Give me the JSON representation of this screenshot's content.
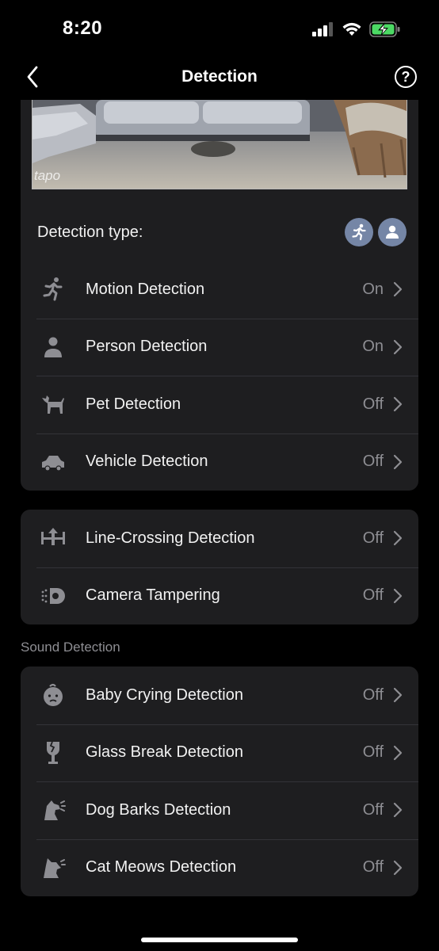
{
  "status_bar": {
    "time": "8:20"
  },
  "nav": {
    "title": "Detection",
    "help_label": "?"
  },
  "preview": {
    "watermark": "tapo"
  },
  "detection_type": {
    "label": "Detection type:",
    "badges": [
      "running-person-icon",
      "person-icon"
    ]
  },
  "object_detection": [
    {
      "icon": "running-person-icon",
      "label": "Motion Detection",
      "value": "On"
    },
    {
      "icon": "person-icon",
      "label": "Person Detection",
      "value": "On"
    },
    {
      "icon": "dog-icon",
      "label": "Pet Detection",
      "value": "Off"
    },
    {
      "icon": "car-icon",
      "label": "Vehicle Detection",
      "value": "Off"
    }
  ],
  "area_detection": [
    {
      "icon": "line-crossing-icon",
      "label": "Line-Crossing Detection",
      "value": "Off"
    },
    {
      "icon": "camera-tampering-icon",
      "label": "Camera Tampering",
      "value": "Off"
    }
  ],
  "sound_section": {
    "header": "Sound Detection",
    "items": [
      {
        "icon": "baby-icon",
        "label": "Baby Crying Detection",
        "value": "Off"
      },
      {
        "icon": "broken-glass-icon",
        "label": "Glass Break Detection",
        "value": "Off"
      },
      {
        "icon": "dog-bark-icon",
        "label": "Dog Barks Detection",
        "value": "Off"
      },
      {
        "icon": "cat-meow-icon",
        "label": "Cat Meows Detection",
        "value": "Off"
      }
    ]
  },
  "colors": {
    "background": "#000000",
    "card": "#1e1e20",
    "secondary_text": "#8e8e93",
    "badge": "#7586a6"
  }
}
